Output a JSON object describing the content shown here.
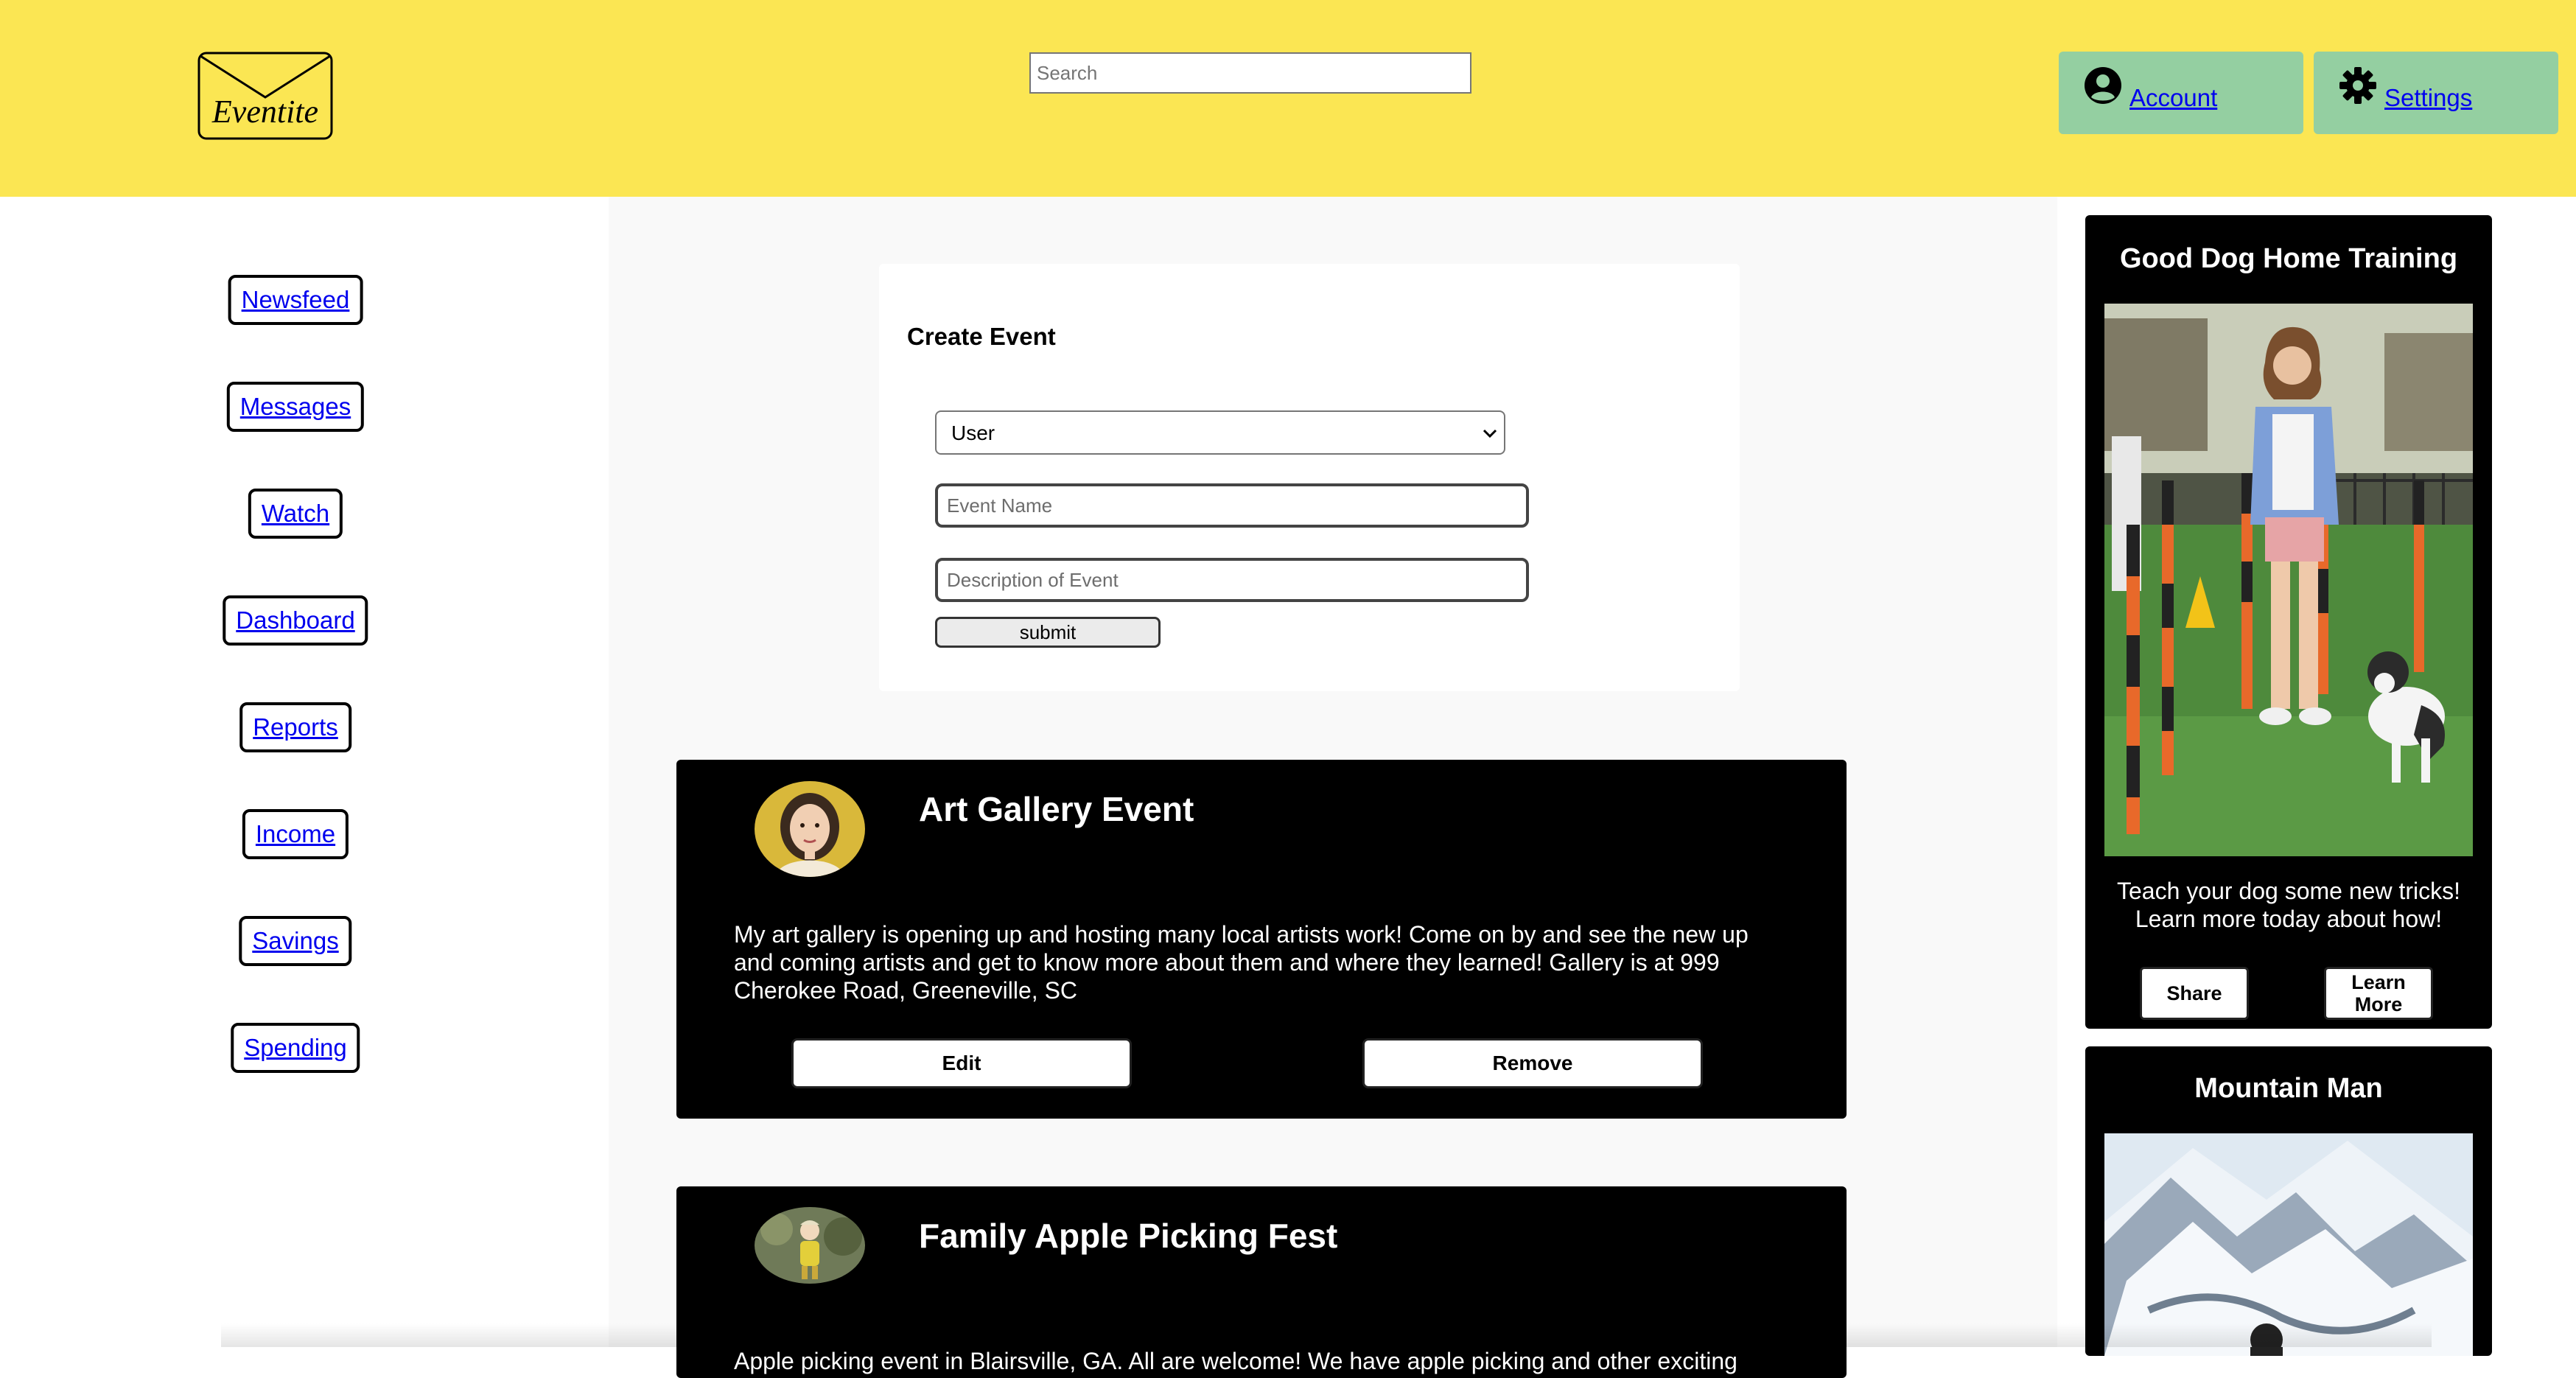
{
  "header": {
    "logo_text": "Eventite",
    "search": {
      "placeholder": "Search",
      "value": ""
    },
    "account_label": "Account",
    "settings_label": "Settings"
  },
  "sidebar": {
    "items": [
      {
        "label": "Newsfeed"
      },
      {
        "label": "Messages"
      },
      {
        "label": "Watch"
      },
      {
        "label": "Dashboard"
      },
      {
        "label": "Reports"
      },
      {
        "label": "Income"
      },
      {
        "label": "Savings"
      },
      {
        "label": "Spending"
      }
    ]
  },
  "create_event": {
    "title": "Create Event",
    "select_value": "User",
    "event_name_placeholder": "Event Name",
    "description_placeholder": "Description of Event",
    "submit_label": "submit"
  },
  "events": [
    {
      "title": "Art Gallery Event",
      "description": "My art gallery is opening up and hosting many local artists work! Come on by and see the new up and coming artists and get to know more about them and where they learned! Gallery is at 999 Cherokee Road, Greeneville, SC",
      "edit_label": "Edit",
      "remove_label": "Remove"
    },
    {
      "title": "Family Apple Picking Fest",
      "description": "Apple picking event in Blairsville, GA. All are welcome! We have apple picking and other exciting"
    }
  ],
  "ads": [
    {
      "title": "Good Dog Home Training",
      "text": "Teach your dog some new tricks! Learn more today about how!",
      "share_label": "Share",
      "learn_more_label": "Learn More"
    },
    {
      "title": "Mountain Man"
    }
  ],
  "colors": {
    "header_bg": "#fbe653",
    "header_button_bg": "#94cfa1",
    "card_bg": "#000000",
    "main_bg": "#f9f9f9"
  }
}
